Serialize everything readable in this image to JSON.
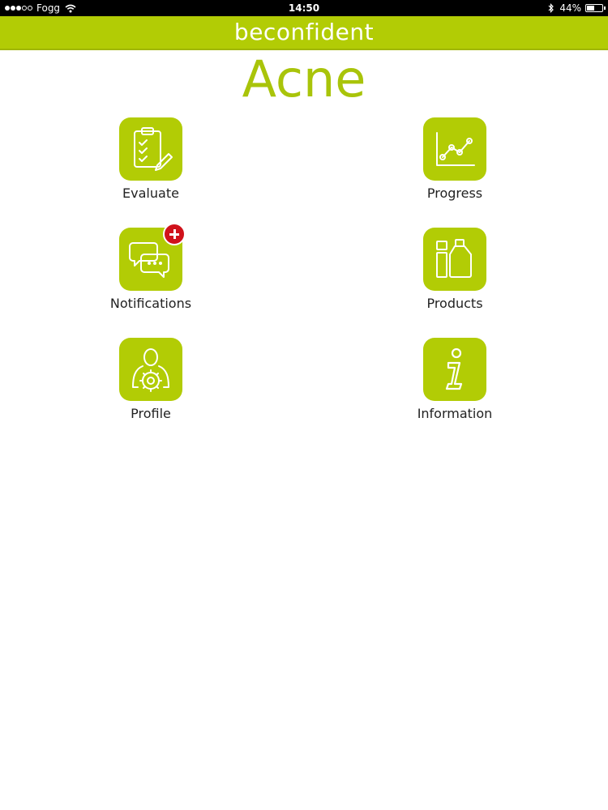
{
  "status_bar": {
    "carrier": "Fogg",
    "time": "14:50",
    "battery": "44%",
    "battery_level": 0.44,
    "signal_bars": 3,
    "signal_total": 5
  },
  "header": {
    "brand": "beconfident"
  },
  "page": {
    "title": "Acne"
  },
  "tiles": [
    {
      "label": "Evaluate",
      "icon": "clipboard-check-icon"
    },
    {
      "label": "Progress",
      "icon": "line-chart-icon"
    },
    {
      "label": "Notifications",
      "icon": "chat-bubbles-icon"
    },
    {
      "label": "Products",
      "icon": "bottles-icon"
    },
    {
      "label": "Profile",
      "icon": "user-gear-icon"
    },
    {
      "label": "Information",
      "icon": "info-icon"
    }
  ],
  "colors": {
    "brand_green": "#b2cc05",
    "title_green": "#a9c40a",
    "badge_red": "#d0121b"
  }
}
